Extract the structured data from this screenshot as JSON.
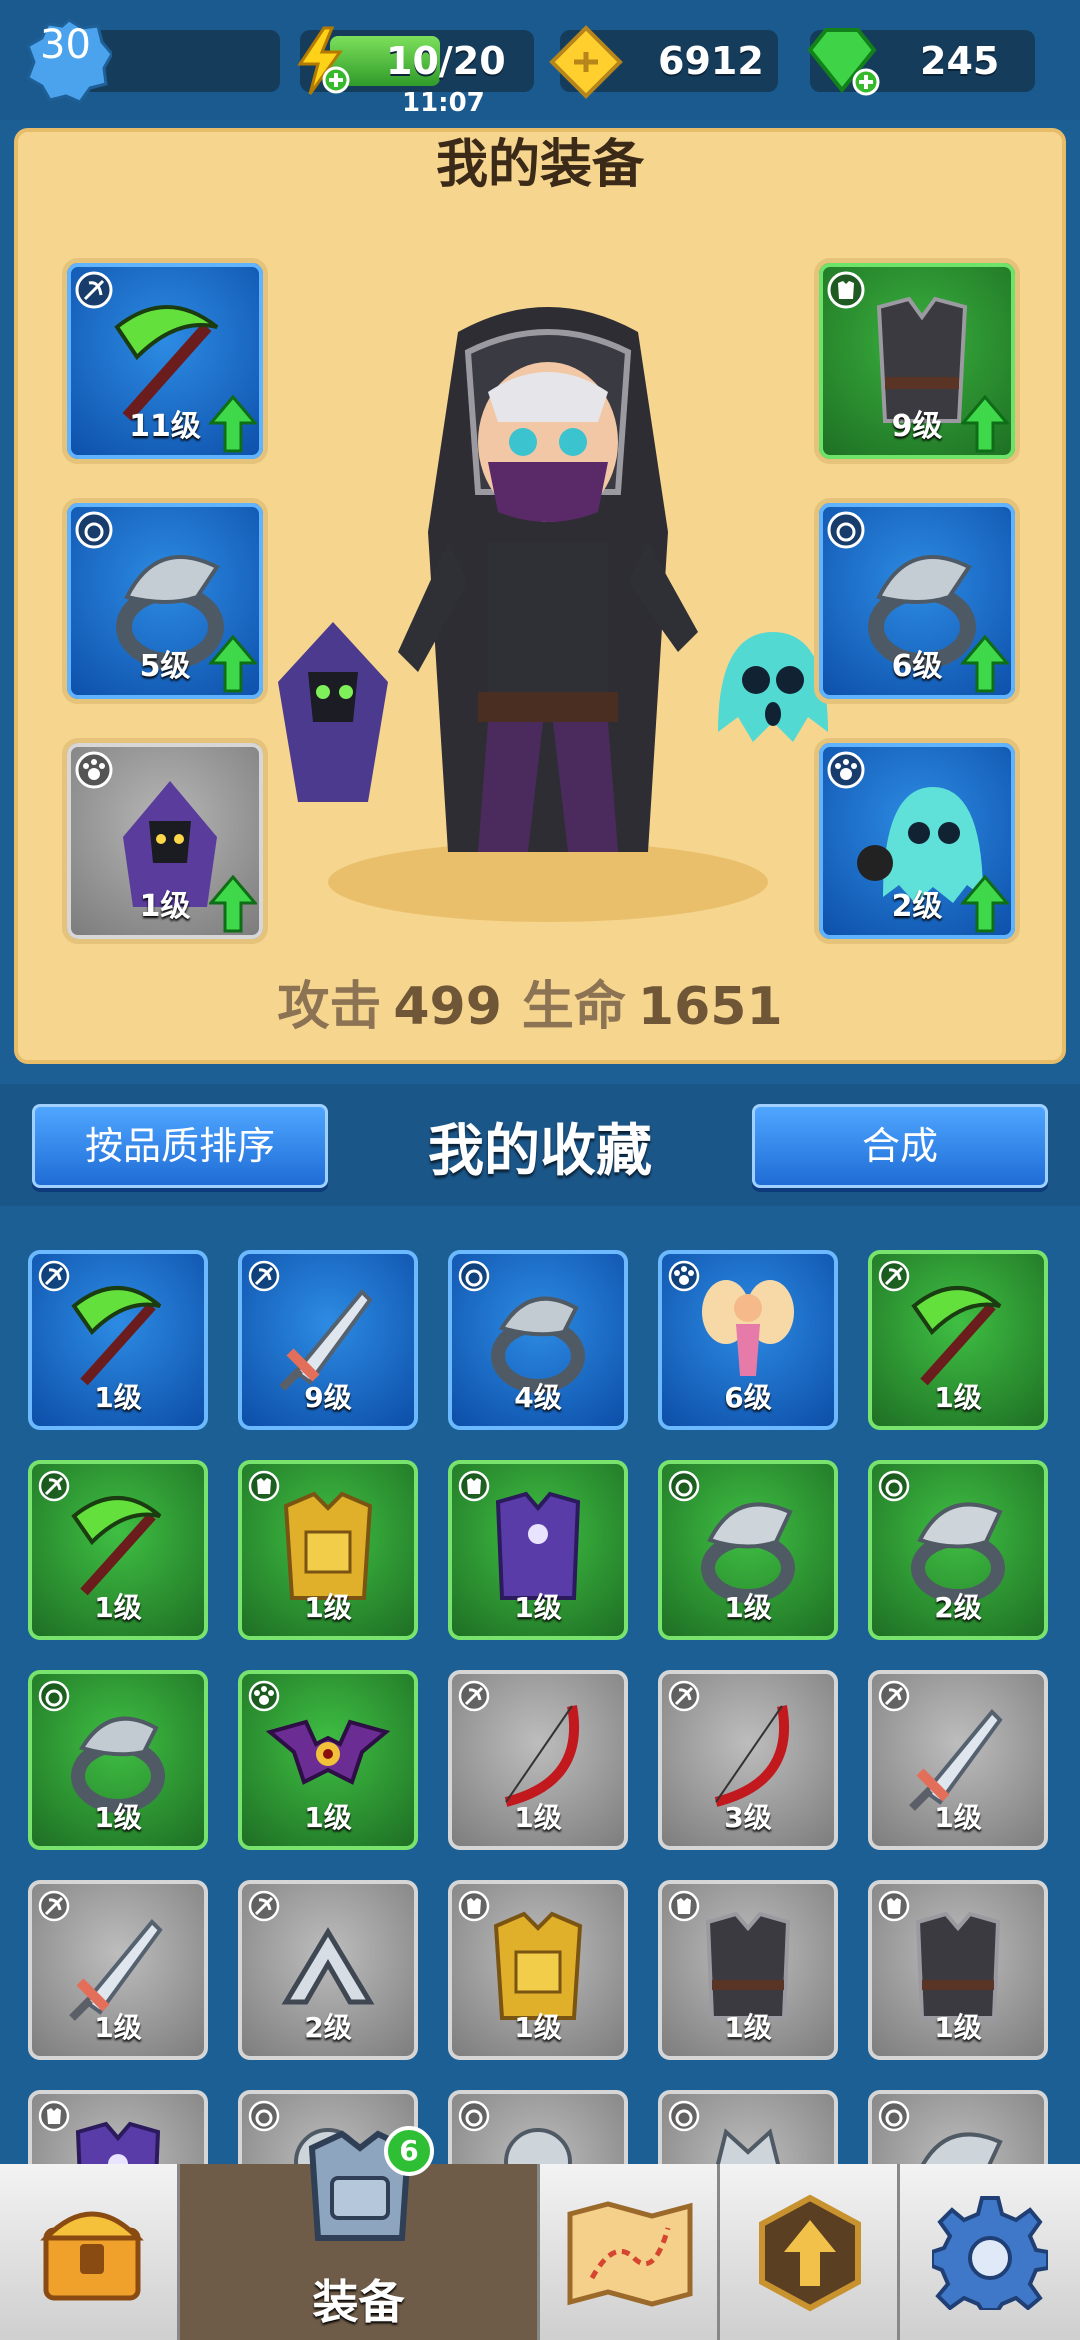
{
  "topbar": {
    "player_level": "30",
    "energy": "10/20",
    "energy_fraction": 0.5,
    "timer": "11:07",
    "gold": "6912",
    "gems": "245"
  },
  "equipment": {
    "title": "我的装备",
    "left_slots": [
      {
        "level": "11级",
        "icon": "scythe-icon",
        "rarity": "blue"
      },
      {
        "level": "5级",
        "icon": "eagle-ring-icon",
        "rarity": "blue"
      },
      {
        "level": "1级",
        "icon": "reaper-pet-icon",
        "rarity": "gray"
      }
    ],
    "right_slots": [
      {
        "level": "9级",
        "icon": "dark-robe-icon",
        "rarity": "green"
      },
      {
        "level": "6级",
        "icon": "eagle-ring-icon",
        "rarity": "blue"
      },
      {
        "level": "2级",
        "icon": "ghost-pet-icon",
        "rarity": "blue"
      }
    ],
    "attack_label": "攻击",
    "attack_value": "499",
    "hp_label": "生命",
    "hp_value": "1651"
  },
  "collection": {
    "title": "我的收藏",
    "sort_button": "按品质排序",
    "merge_button": "合成",
    "items": [
      {
        "level": "1级",
        "icon": "scythe-icon",
        "rarity": "blue"
      },
      {
        "level": "9级",
        "icon": "sword-icon",
        "rarity": "blue"
      },
      {
        "level": "4级",
        "icon": "snake-ring-icon",
        "rarity": "blue"
      },
      {
        "level": "6级",
        "icon": "fairy-pet-icon",
        "rarity": "blue"
      },
      {
        "level": "1级",
        "icon": "scythe-icon",
        "rarity": "green"
      },
      {
        "level": "1级",
        "icon": "scythe-icon",
        "rarity": "green"
      },
      {
        "level": "1级",
        "icon": "gold-armor-icon",
        "rarity": "green"
      },
      {
        "level": "1级",
        "icon": "purple-robe-icon",
        "rarity": "green"
      },
      {
        "level": "1级",
        "icon": "eagle-ring-icon",
        "rarity": "green"
      },
      {
        "level": "2级",
        "icon": "eagle-ring-icon",
        "rarity": "green"
      },
      {
        "level": "1级",
        "icon": "snake-ring-icon",
        "rarity": "green"
      },
      {
        "level": "1级",
        "icon": "bat-pet-icon",
        "rarity": "green"
      },
      {
        "level": "1级",
        "icon": "bow-icon",
        "rarity": "gray"
      },
      {
        "level": "3级",
        "icon": "bow-icon",
        "rarity": "gray"
      },
      {
        "level": "1级",
        "icon": "sword-icon",
        "rarity": "gray"
      },
      {
        "level": "1级",
        "icon": "sword-icon",
        "rarity": "gray"
      },
      {
        "level": "2级",
        "icon": "boomerang-icon",
        "rarity": "gray"
      },
      {
        "level": "1级",
        "icon": "gold-armor-icon",
        "rarity": "gray"
      },
      {
        "level": "1级",
        "icon": "dark-robe-icon",
        "rarity": "gray"
      },
      {
        "level": "1级",
        "icon": "dark-robe-icon",
        "rarity": "gray"
      },
      {
        "level": "",
        "icon": "purple-robe-icon",
        "rarity": "gray"
      },
      {
        "level": "",
        "icon": "panda-ring-icon",
        "rarity": "gray"
      },
      {
        "level": "",
        "icon": "panda-ring-icon",
        "rarity": "gray"
      },
      {
        "level": "",
        "icon": "wolf-ring-icon",
        "rarity": "gray"
      },
      {
        "level": "",
        "icon": "eagle-ring-icon",
        "rarity": "gray"
      }
    ]
  },
  "nav": {
    "equip_label": "装备",
    "equip_badge": "6",
    "items": [
      "chest-icon",
      "armor-icon",
      "map-icon",
      "upgrade-icon",
      "gear-icon"
    ]
  }
}
